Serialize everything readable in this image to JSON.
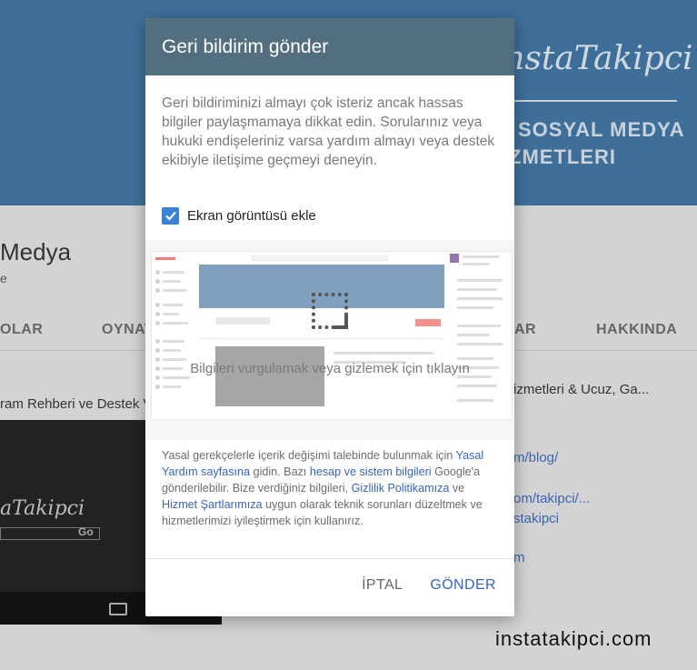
{
  "background": {
    "logo_text": "InstaTakipci",
    "slogan_line1": "SOSYAL MEDYA",
    "slogan_line2": "ZMETLERI",
    "channel_name": "Medya",
    "channel_sub": "e",
    "tabs": [
      "OLAR",
      "OYNAT",
      "AR",
      "HAKKINDA"
    ],
    "video_title": "ram Rehberi ve Destek V",
    "video_logo": "aTakipci",
    "video_go": "Go",
    "right_title": "izmetleri & Ucuz, Ga...",
    "links": [
      "m/blog/",
      "om/takipci/...",
      "stakipci",
      "m"
    ],
    "watermark": "instatakipci.com",
    "colors": {
      "banner": "#3f6f99",
      "dim": "#d3d3d3"
    }
  },
  "dialog": {
    "title": "Geri bildirim gönder",
    "intro": "Geri bildiriminizi almayı çok isteriz ancak hassas bilgiler paylaşmamaya dikkat edin. Sorularınız veya hukuki endişeleriniz varsa yardım almayı veya destek ekibiyle iletişime geçmeyi deneyin.",
    "checkbox": {
      "label": "Ekran görüntüsü ekle",
      "checked": true
    },
    "screenshot_hint": "Bilgileri vurgulamak veya gizlemek için tıklayın",
    "legal": {
      "p1": "Yasal gerekçelerle içerik değişimi talebinde bulunmak için ",
      "link_legal": "Yasal Yardım sayfasına",
      "p2": " gidin. Bazı ",
      "link_system": "hesap ve sistem bilgileri",
      "p3": " Google'a gönderilebilir. Bize verdiğiniz bilgileri, ",
      "link_privacy": "Gizlilik Politikamıza",
      "p4": " ve ",
      "link_terms": "Hizmet Şartlarımıza",
      "p5": " uygun olarak teknik sorunları düzeltmek ve hizmetlerimizi iyileştirmek için kullanırız."
    },
    "cancel_label": "İPTAL",
    "send_label": "GÖNDER",
    "colors": {
      "header": "#536f7f",
      "accent": "#3b82d6",
      "link": "#3a66b8"
    }
  }
}
